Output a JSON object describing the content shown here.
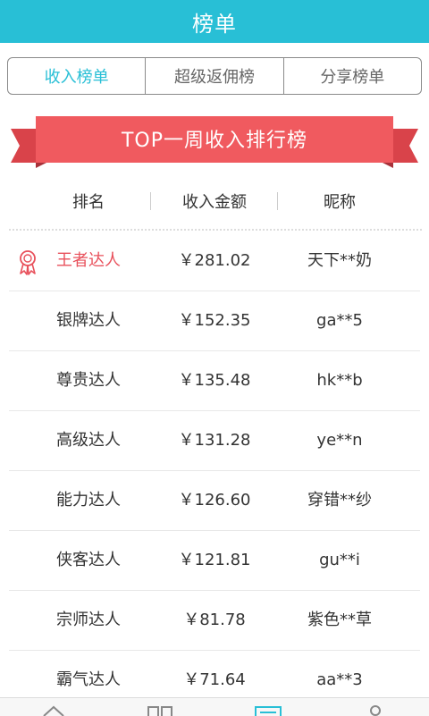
{
  "header": {
    "title": "榜单"
  },
  "tabs": [
    {
      "label": "收入榜单",
      "active": true
    },
    {
      "label": "超级返佣榜",
      "active": false
    },
    {
      "label": "分享榜单",
      "active": false
    }
  ],
  "banner": {
    "title": "TOP一周收入排行榜"
  },
  "columns": {
    "rank": "排名",
    "amount": "收入金额",
    "nickname": "昵称"
  },
  "rows": [
    {
      "rank": "王者达人",
      "amount": "￥281.02",
      "nickname": "天下**奶"
    },
    {
      "rank": "银牌达人",
      "amount": "￥152.35",
      "nickname": "ga**5"
    },
    {
      "rank": "尊贵达人",
      "amount": "￥135.48",
      "nickname": "hk**b"
    },
    {
      "rank": "高级达人",
      "amount": "￥131.28",
      "nickname": "ye**n"
    },
    {
      "rank": "能力达人",
      "amount": "￥126.60",
      "nickname": "穿错**纱"
    },
    {
      "rank": "侠客达人",
      "amount": "￥121.81",
      "nickname": "gu**i"
    },
    {
      "rank": "宗师达人",
      "amount": "￥81.78",
      "nickname": "紫色**草"
    },
    {
      "rank": "霸气达人",
      "amount": "￥71.64",
      "nickname": "aa**3"
    }
  ],
  "colors": {
    "accent": "#28bfd6",
    "banner": "#f05a5f",
    "highlight": "#e8505b"
  },
  "icons": {
    "first_place": "medal-icon",
    "nav": [
      "home-icon",
      "grid-icon",
      "list-icon",
      "user-icon"
    ]
  }
}
